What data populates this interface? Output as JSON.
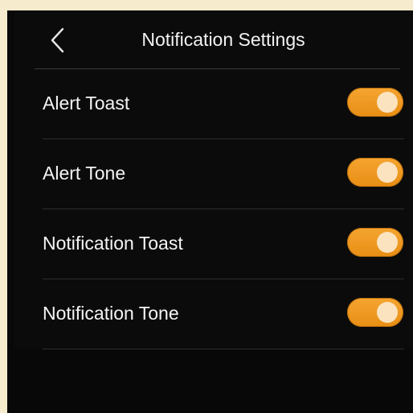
{
  "header": {
    "title": "Notification Settings",
    "back_icon": "chevron-left-icon"
  },
  "settings": [
    {
      "label": "Alert Toast",
      "enabled": true
    },
    {
      "label": "Alert Tone",
      "enabled": true
    },
    {
      "label": "Notification Toast",
      "enabled": true
    },
    {
      "label": "Notification Tone",
      "enabled": true
    }
  ],
  "colors": {
    "background": "#0b0b0b",
    "toggle_on": "#f09a22",
    "knob": "#fbe3c0",
    "text": "#f4f4f4"
  }
}
